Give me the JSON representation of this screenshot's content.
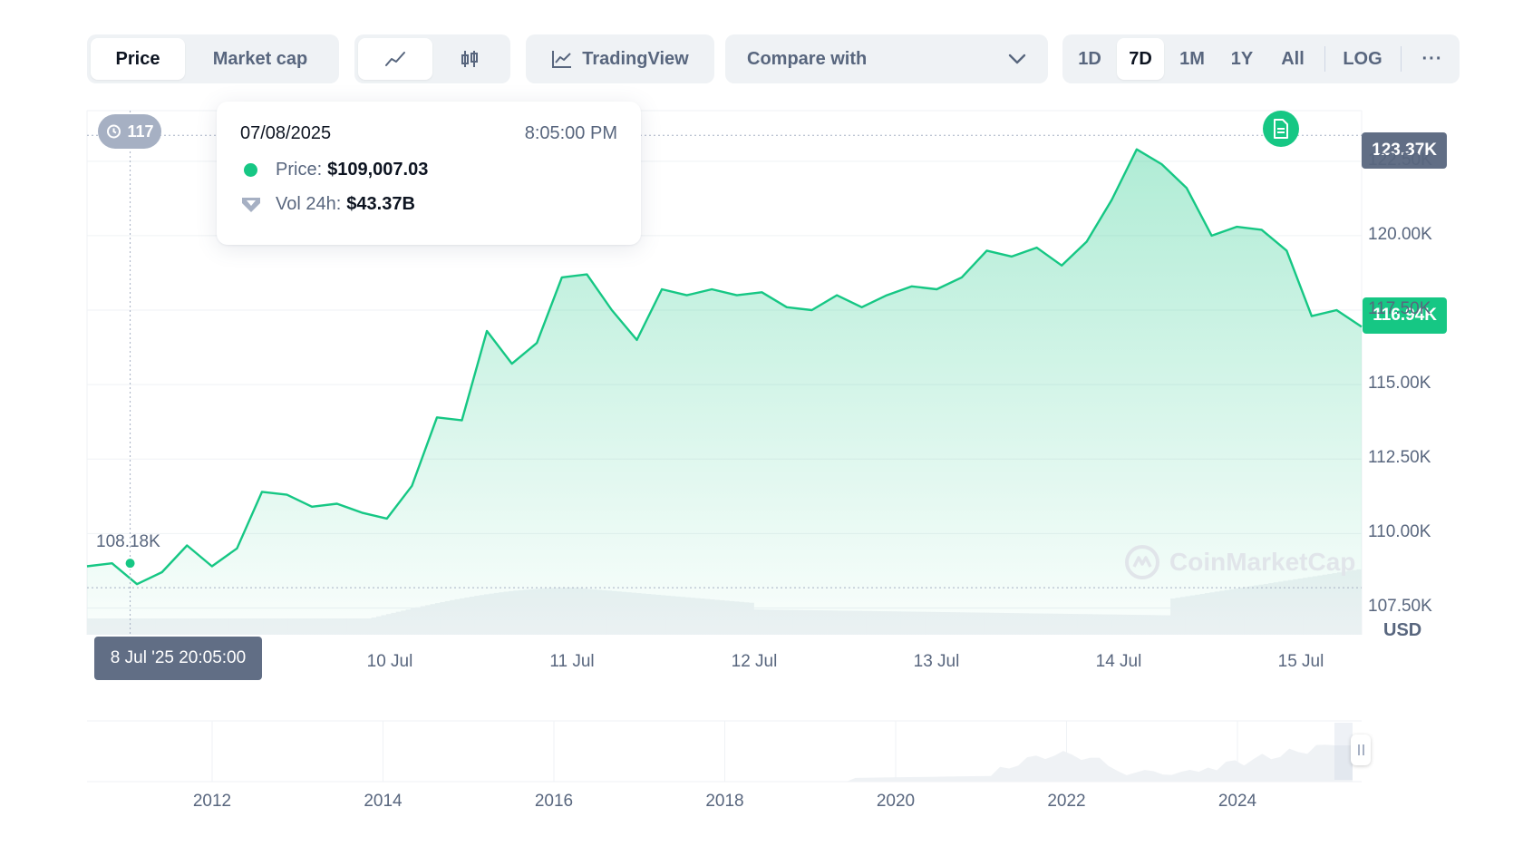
{
  "toolbar": {
    "view_tabs": [
      {
        "label": "Price",
        "active": true
      },
      {
        "label": "Market cap",
        "active": false
      }
    ],
    "chart_type_icons": [
      "line-chart-icon",
      "candlestick-icon"
    ],
    "tradingview_label": "TradingView",
    "compare_label": "Compare with",
    "ranges": [
      {
        "label": "1D",
        "active": false
      },
      {
        "label": "7D",
        "active": true
      },
      {
        "label": "1M",
        "active": false
      },
      {
        "label": "1Y",
        "active": false
      },
      {
        "label": "All",
        "active": false
      }
    ],
    "log_label": "LOG",
    "more_label": "···"
  },
  "tooltip": {
    "date": "07/08/2025",
    "time": "8:05:00 PM",
    "price_label": "Price:",
    "price_value": "$109,007.03",
    "vol_label": "Vol 24h:",
    "vol_value": "$43.37B"
  },
  "badges": {
    "history_count": "117",
    "crosshair_date": "8 Jul '25 20:05:00",
    "high_tag": "123.37K",
    "current_tag": "116.94K",
    "low_label": "108.18K",
    "currency": "USD",
    "watermark": "CoinMarketCap"
  },
  "colors": {
    "up": "#16c784",
    "text_muted": "#58667e",
    "tag_dark": "#616e85",
    "grid": "#eff2f5"
  },
  "chart_data": {
    "type": "area",
    "title": "",
    "ylabel": "USD",
    "ylim": [
      106600,
      124200
    ],
    "y_ticks": [
      "122.50K",
      "120.00K",
      "117.50K",
      "115.00K",
      "112.50K",
      "110.00K",
      "107.50K"
    ],
    "x_ticks": [
      "10 Jul",
      "11 Jul",
      "12 Jul",
      "13 Jul",
      "14 Jul",
      "15 Jul"
    ],
    "high": 123370,
    "low": 108180,
    "current": 116940,
    "series": [
      {
        "x": [
          "8 Jul",
          "8 Jul",
          "8 Jul",
          "9 Jul",
          "9 Jul",
          "9 Jul",
          "9 Jul",
          "10 Jul",
          "10 Jul",
          "10 Jul",
          "10 Jul",
          "10 Jul",
          "10 Jul",
          "10 Jul",
          "11 Jul",
          "11 Jul",
          "11 Jul",
          "11 Jul",
          "11 Jul",
          "11 Jul",
          "11 Jul",
          "11 Jul",
          "11 Jul",
          "12 Jul",
          "12 Jul",
          "12 Jul",
          "12 Jul",
          "12 Jul",
          "12 Jul",
          "13 Jul",
          "13 Jul",
          "13 Jul",
          "13 Jul",
          "13 Jul",
          "13 Jul",
          "14 Jul",
          "14 Jul",
          "14 Jul",
          "14 Jul",
          "14 Jul",
          "14 Jul",
          "14 Jul",
          "14 Jul",
          "14 Jul",
          "15 Jul",
          "15 Jul",
          "15 Jul",
          "15 Jul",
          "15 Jul",
          "15 Jul",
          "15 Jul",
          "15 Jul"
        ],
        "values": [
          108900,
          109000,
          108300,
          108700,
          109600,
          108900,
          109500,
          111400,
          111300,
          110900,
          111000,
          110700,
          110500,
          111600,
          113900,
          113800,
          116800,
          115700,
          116400,
          118600,
          118700,
          117500,
          116500,
          118200,
          118000,
          118200,
          118000,
          118100,
          117600,
          117500,
          118000,
          117600,
          118000,
          118300,
          118200,
          118600,
          119500,
          119300,
          119600,
          119000,
          119800,
          121200,
          122900,
          122400,
          121600,
          120000,
          120300,
          120200,
          119500,
          117300,
          117500,
          116940
        ]
      }
    ],
    "volume_ranges": {
      "x_axis": [
        "2012",
        "2014",
        "2016",
        "2018",
        "2020",
        "2022",
        "2024"
      ]
    }
  }
}
